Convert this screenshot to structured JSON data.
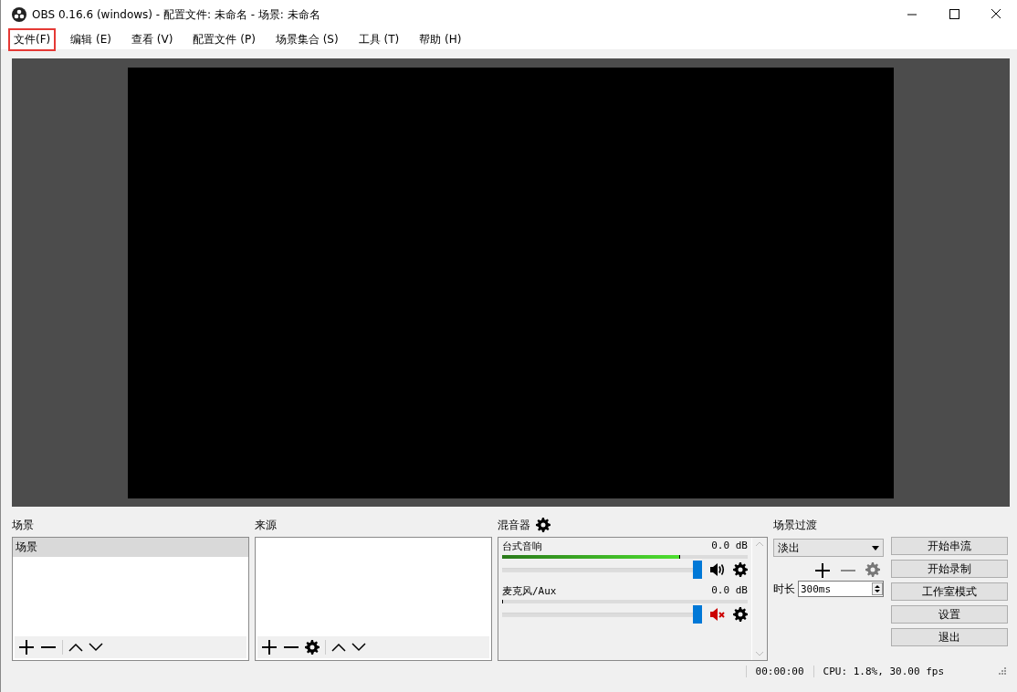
{
  "window": {
    "title": "OBS 0.16.6 (windows) - 配置文件: 未命名 - 场景: 未命名"
  },
  "menu": [
    {
      "label": "文件(F)",
      "highlighted": true
    },
    {
      "label": "编辑 (E)",
      "highlighted": false
    },
    {
      "label": "查看 (V)",
      "highlighted": false
    },
    {
      "label": "配置文件 (P)",
      "highlighted": false
    },
    {
      "label": "场景集合 (S)",
      "highlighted": false
    },
    {
      "label": "工具 (T)",
      "highlighted": false
    },
    {
      "label": "帮助 (H)",
      "highlighted": false
    }
  ],
  "scenes": {
    "title": "场景",
    "items": [
      {
        "label": "场景",
        "selected": true
      }
    ]
  },
  "sources": {
    "title": "来源"
  },
  "mixer": {
    "title": "混音器",
    "channels": [
      {
        "name": "台式音响",
        "reading": "0.0 dB",
        "meter": {
          "level": 0.72
        },
        "volume": {
          "level": 1
        },
        "muted": false
      },
      {
        "name": "麦克风/Aux",
        "reading": "0.0 dB",
        "meter": {
          "level": 0
        },
        "volume": {
          "level": 1
        },
        "muted": true
      }
    ]
  },
  "transitions": {
    "title": "场景过渡",
    "selected_transition": "淡出",
    "duration_label": "时长",
    "duration": "300ms"
  },
  "controls": [
    "开始串流",
    "开始录制",
    "工作室模式",
    "设置",
    "退出"
  ],
  "status_bar": {
    "time": "00:00:00",
    "stats": "CPU: 1.8%, 30.00 fps"
  }
}
